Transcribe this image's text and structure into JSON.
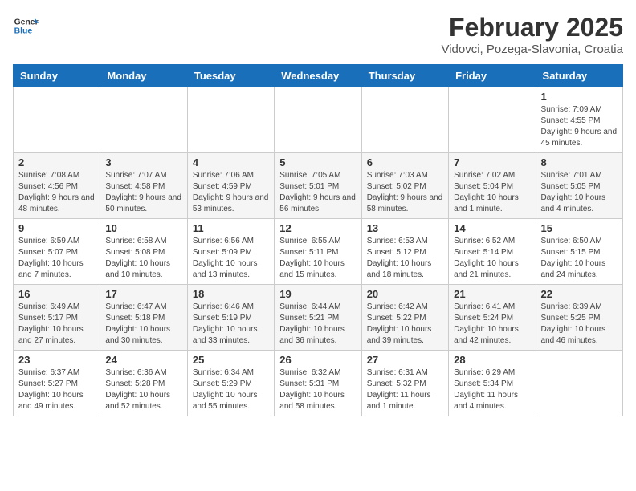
{
  "header": {
    "logo_line1": "General",
    "logo_line2": "Blue",
    "title": "February 2025",
    "subtitle": "Vidovci, Pozega-Slavonia, Croatia"
  },
  "days_of_week": [
    "Sunday",
    "Monday",
    "Tuesday",
    "Wednesday",
    "Thursday",
    "Friday",
    "Saturday"
  ],
  "weeks": [
    [
      {
        "day": "",
        "info": ""
      },
      {
        "day": "",
        "info": ""
      },
      {
        "day": "",
        "info": ""
      },
      {
        "day": "",
        "info": ""
      },
      {
        "day": "",
        "info": ""
      },
      {
        "day": "",
        "info": ""
      },
      {
        "day": "1",
        "info": "Sunrise: 7:09 AM\nSunset: 4:55 PM\nDaylight: 9 hours and 45 minutes."
      }
    ],
    [
      {
        "day": "2",
        "info": "Sunrise: 7:08 AM\nSunset: 4:56 PM\nDaylight: 9 hours and 48 minutes."
      },
      {
        "day": "3",
        "info": "Sunrise: 7:07 AM\nSunset: 4:58 PM\nDaylight: 9 hours and 50 minutes."
      },
      {
        "day": "4",
        "info": "Sunrise: 7:06 AM\nSunset: 4:59 PM\nDaylight: 9 hours and 53 minutes."
      },
      {
        "day": "5",
        "info": "Sunrise: 7:05 AM\nSunset: 5:01 PM\nDaylight: 9 hours and 56 minutes."
      },
      {
        "day": "6",
        "info": "Sunrise: 7:03 AM\nSunset: 5:02 PM\nDaylight: 9 hours and 58 minutes."
      },
      {
        "day": "7",
        "info": "Sunrise: 7:02 AM\nSunset: 5:04 PM\nDaylight: 10 hours and 1 minute."
      },
      {
        "day": "8",
        "info": "Sunrise: 7:01 AM\nSunset: 5:05 PM\nDaylight: 10 hours and 4 minutes."
      }
    ],
    [
      {
        "day": "9",
        "info": "Sunrise: 6:59 AM\nSunset: 5:07 PM\nDaylight: 10 hours and 7 minutes."
      },
      {
        "day": "10",
        "info": "Sunrise: 6:58 AM\nSunset: 5:08 PM\nDaylight: 10 hours and 10 minutes."
      },
      {
        "day": "11",
        "info": "Sunrise: 6:56 AM\nSunset: 5:09 PM\nDaylight: 10 hours and 13 minutes."
      },
      {
        "day": "12",
        "info": "Sunrise: 6:55 AM\nSunset: 5:11 PM\nDaylight: 10 hours and 15 minutes."
      },
      {
        "day": "13",
        "info": "Sunrise: 6:53 AM\nSunset: 5:12 PM\nDaylight: 10 hours and 18 minutes."
      },
      {
        "day": "14",
        "info": "Sunrise: 6:52 AM\nSunset: 5:14 PM\nDaylight: 10 hours and 21 minutes."
      },
      {
        "day": "15",
        "info": "Sunrise: 6:50 AM\nSunset: 5:15 PM\nDaylight: 10 hours and 24 minutes."
      }
    ],
    [
      {
        "day": "16",
        "info": "Sunrise: 6:49 AM\nSunset: 5:17 PM\nDaylight: 10 hours and 27 minutes."
      },
      {
        "day": "17",
        "info": "Sunrise: 6:47 AM\nSunset: 5:18 PM\nDaylight: 10 hours and 30 minutes."
      },
      {
        "day": "18",
        "info": "Sunrise: 6:46 AM\nSunset: 5:19 PM\nDaylight: 10 hours and 33 minutes."
      },
      {
        "day": "19",
        "info": "Sunrise: 6:44 AM\nSunset: 5:21 PM\nDaylight: 10 hours and 36 minutes."
      },
      {
        "day": "20",
        "info": "Sunrise: 6:42 AM\nSunset: 5:22 PM\nDaylight: 10 hours and 39 minutes."
      },
      {
        "day": "21",
        "info": "Sunrise: 6:41 AM\nSunset: 5:24 PM\nDaylight: 10 hours and 42 minutes."
      },
      {
        "day": "22",
        "info": "Sunrise: 6:39 AM\nSunset: 5:25 PM\nDaylight: 10 hours and 46 minutes."
      }
    ],
    [
      {
        "day": "23",
        "info": "Sunrise: 6:37 AM\nSunset: 5:27 PM\nDaylight: 10 hours and 49 minutes."
      },
      {
        "day": "24",
        "info": "Sunrise: 6:36 AM\nSunset: 5:28 PM\nDaylight: 10 hours and 52 minutes."
      },
      {
        "day": "25",
        "info": "Sunrise: 6:34 AM\nSunset: 5:29 PM\nDaylight: 10 hours and 55 minutes."
      },
      {
        "day": "26",
        "info": "Sunrise: 6:32 AM\nSunset: 5:31 PM\nDaylight: 10 hours and 58 minutes."
      },
      {
        "day": "27",
        "info": "Sunrise: 6:31 AM\nSunset: 5:32 PM\nDaylight: 11 hours and 1 minute."
      },
      {
        "day": "28",
        "info": "Sunrise: 6:29 AM\nSunset: 5:34 PM\nDaylight: 11 hours and 4 minutes."
      },
      {
        "day": "",
        "info": ""
      }
    ]
  ]
}
